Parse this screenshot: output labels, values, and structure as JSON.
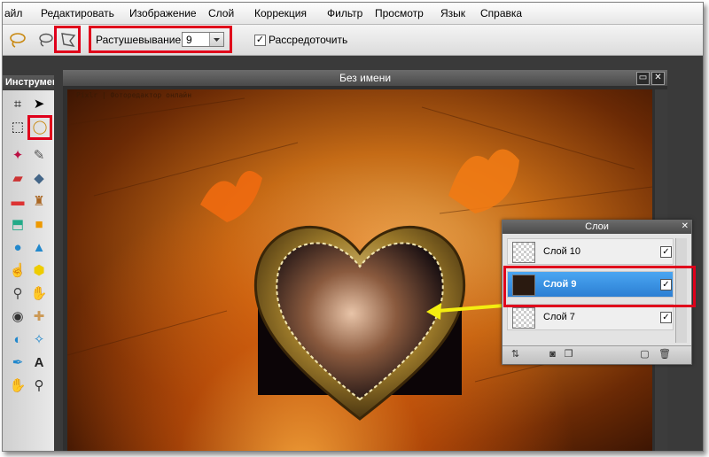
{
  "menu": [
    "айл",
    "Редактировать",
    "Изображение",
    "Слой",
    "Коррекция",
    "Фильтр",
    "Просмотр",
    "Язык",
    "Справка"
  ],
  "options": {
    "feather_label": "Растушевывание:",
    "feather_value": "9",
    "spread_label": "Рассредоточить",
    "spread_checked": "✓"
  },
  "tools_panel": {
    "title": "Инструменты"
  },
  "document": {
    "title": "Без имени",
    "watermark": "Pixlr | Фоторедактор онлайн",
    "minimize": "▭",
    "close": "✕"
  },
  "layers": {
    "title": "Слои",
    "close": "✕",
    "rows": [
      {
        "name": "Слой 10",
        "check": "✓"
      },
      {
        "name": "Слой 9",
        "check": "✓"
      },
      {
        "name": "Слой 7",
        "check": "✓"
      }
    ]
  },
  "colors": {
    "highlight": "#e0001b",
    "arrow": "#f4ee10",
    "selection": "#3a95ea"
  }
}
